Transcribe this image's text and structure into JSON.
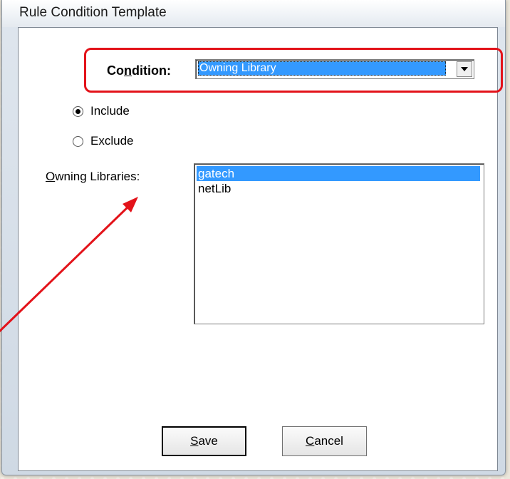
{
  "window": {
    "title": "Rule Condition Template"
  },
  "condition": {
    "label": "Condition:",
    "selected": "Owning Library"
  },
  "scope": {
    "include_label": "Include",
    "exclude_label": "Exclude",
    "selected": "Include"
  },
  "libraries": {
    "label": "Owning Libraries:",
    "items": [
      {
        "name": "gatech",
        "selected": true
      },
      {
        "name": "netLib",
        "selected": false
      }
    ]
  },
  "buttons": {
    "save": "Save",
    "cancel": "Cancel"
  },
  "annotation": {
    "color": "#e3131a"
  },
  "colors": {
    "selection": "#3399ff"
  }
}
